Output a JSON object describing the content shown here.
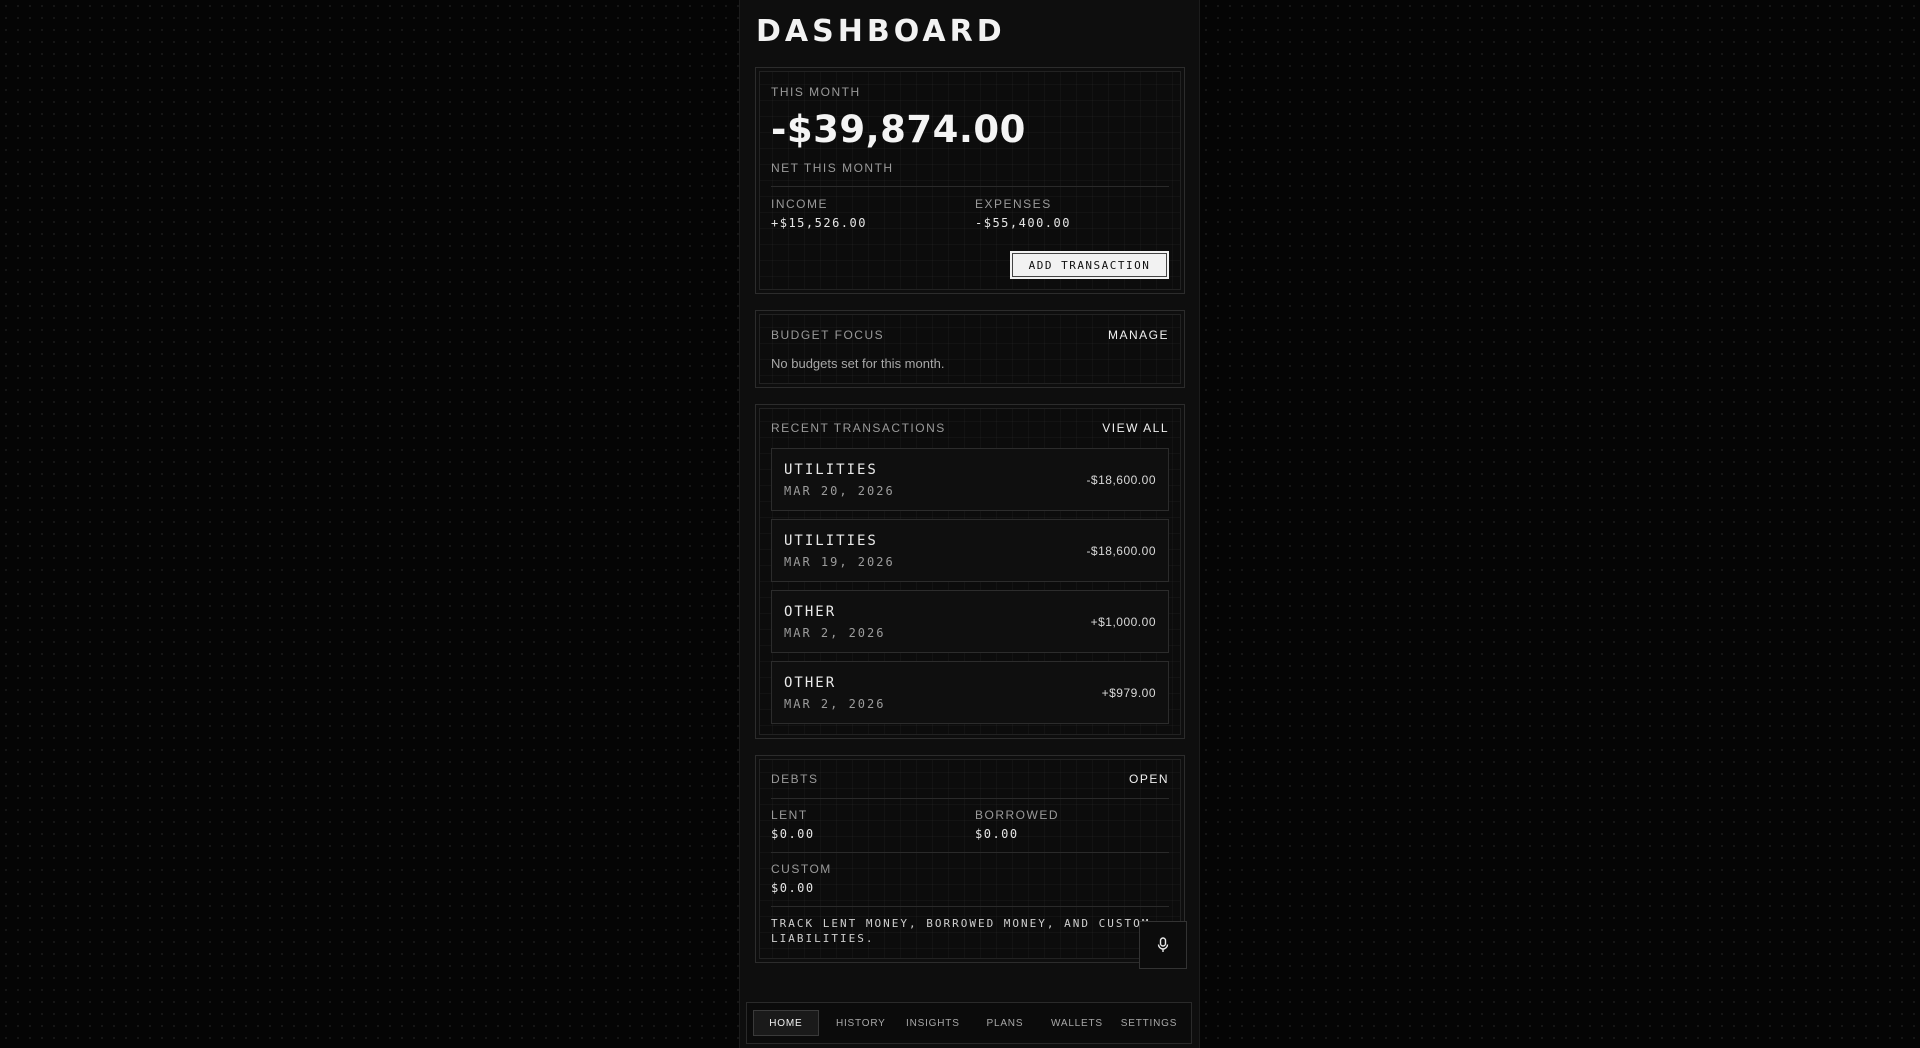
{
  "page": {
    "title": "DASHBOARD"
  },
  "summary": {
    "period_label": "THIS MONTH",
    "net_amount": "-$39,874.00",
    "net_label": "NET THIS MONTH",
    "income_label": "INCOME",
    "income_value": "+$15,526.00",
    "expenses_label": "EXPENSES",
    "expenses_value": "-$55,400.00",
    "add_button": "ADD TRANSACTION"
  },
  "budget": {
    "title": "BUDGET FOCUS",
    "manage_link": "MANAGE",
    "empty_text": "No budgets set for this month."
  },
  "transactions": {
    "title": "RECENT TRANSACTIONS",
    "view_all_link": "VIEW ALL",
    "items": [
      {
        "category": "UTILITIES",
        "date": "MAR 20, 2026",
        "amount": "-$18,600.00"
      },
      {
        "category": "UTILITIES",
        "date": "MAR 19, 2026",
        "amount": "-$18,600.00"
      },
      {
        "category": "OTHER",
        "date": "MAR 2, 2026",
        "amount": "+$1,000.00"
      },
      {
        "category": "OTHER",
        "date": "MAR 2, 2026",
        "amount": "+$979.00"
      }
    ]
  },
  "debts": {
    "title": "DEBTS",
    "open_link": "OPEN",
    "lent_label": "LENT",
    "lent_value": "$0.00",
    "borrowed_label": "BORROWED",
    "borrowed_value": "$0.00",
    "custom_label": "CUSTOM",
    "custom_value": "$0.00",
    "note": "TRACK LENT MONEY, BORROWED MONEY, AND CUSTOM LIABILITIES."
  },
  "mic": {
    "icon": "microphone-icon"
  },
  "nav": {
    "items": [
      {
        "label": "HOME",
        "active": true
      },
      {
        "label": "HISTORY"
      },
      {
        "label": "INSIGHTS"
      },
      {
        "label": "PLANS"
      },
      {
        "label": "WALLETS"
      },
      {
        "label": "SETTINGS"
      }
    ]
  }
}
